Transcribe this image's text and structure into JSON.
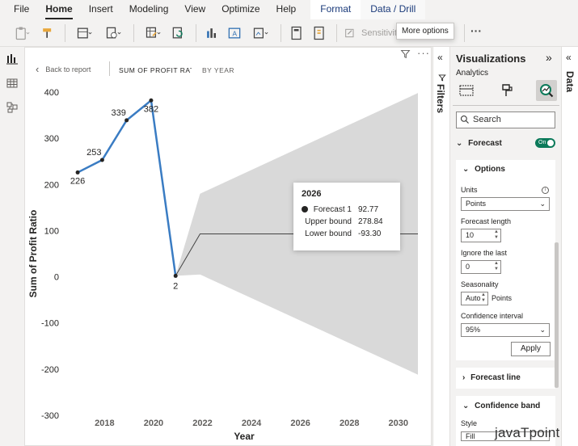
{
  "ribbon": {
    "tabs": [
      "File",
      "Home",
      "Insert",
      "Modeling",
      "View",
      "Optimize",
      "Help"
    ],
    "context_tabs": [
      "Format",
      "Data / Drill"
    ],
    "sensitivity_label": "Sensitivity",
    "sensitivity_tail": "n",
    "tooltip": "More options",
    "more": "···"
  },
  "report": {
    "back_label": "Back to report",
    "crumb_measure": "SUM OF PROFIT RATIO",
    "crumb_axis": "BY YEAR",
    "more": "···"
  },
  "chart_data": {
    "type": "line",
    "title": "",
    "xlabel": "Year",
    "ylabel": "Sum of Profit Ratio",
    "ylim": [
      -300,
      400
    ],
    "yticks": [
      400,
      300,
      200,
      100,
      0,
      -100,
      -200,
      -300
    ],
    "xlim": [
      2016.6,
      2030.8
    ],
    "xticks": [
      2018,
      2020,
      2022,
      2024,
      2026,
      2028,
      2030
    ],
    "series": [
      {
        "x": [
          2016.9,
          2017.9,
          2018.9,
          2019.9,
          2020.9
        ],
        "values": [
          226,
          253,
          339,
          382,
          2
        ],
        "labels": [
          "226",
          "253",
          "339",
          "382",
          "2"
        ],
        "color": "#3a7cc3"
      }
    ],
    "forecast": {
      "x": [
        2020.9,
        2021.9,
        2030.8
      ],
      "values": [
        2,
        92.77,
        92.77
      ],
      "upper": [
        2,
        180,
        398
      ],
      "lower": [
        2,
        5,
        -212
      ],
      "color": "#444444",
      "band_color": "#d9d9d9"
    },
    "grid": false,
    "legend": "none"
  },
  "hover": {
    "year": "2026",
    "rows": [
      {
        "label": "Forecast 1",
        "value": "92.77"
      },
      {
        "label": "Upper bound",
        "value": "278.84"
      },
      {
        "label": "Lower bound",
        "value": "-93.30"
      }
    ]
  },
  "filters": {
    "label": "Filters"
  },
  "data_pane": {
    "label": "Data"
  },
  "viz": {
    "title": "Visualizations",
    "subtitle": "Analytics",
    "search_placeholder": "Search",
    "forecast_label": "Forecast",
    "toggle_label": "On",
    "options": {
      "header": "Options",
      "units_label": "Units",
      "units_value": "Points",
      "length_label": "Forecast length",
      "length_value": "10",
      "ignore_label": "Ignore the last",
      "ignore_value": "0",
      "seasonality_label": "Seasonality",
      "seasonality_value": "Auto",
      "seasonality_unit": "Points",
      "confidence_label": "Confidence interval",
      "confidence_value": "95%",
      "apply_label": "Apply"
    },
    "forecast_line_label": "Forecast line",
    "confidence_band_label": "Confidence band",
    "style_label": "Style",
    "style_value": "Fill"
  },
  "watermark": {
    "brand": "javaTpoint"
  },
  "colors": {
    "accent": "#0b7a5a",
    "line": "#3a7cc3"
  }
}
